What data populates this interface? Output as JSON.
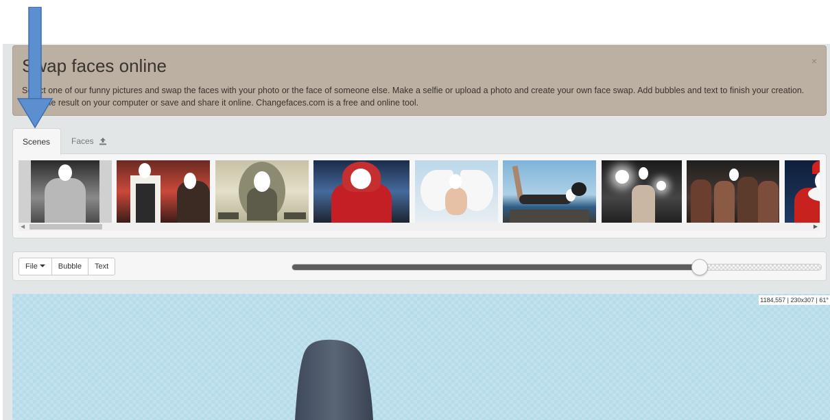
{
  "banner": {
    "title": "Swap faces online",
    "text": "Select one of our funny pictures and swap the faces with your photo or the face of someone else. Make a selfie or upload a photo and create your own face swap. Add bubbles and text to finish your creation. Save the result on your computer or save and share it online. Changefaces.com is a free and online tool.",
    "close": "×"
  },
  "tabs": [
    {
      "label": "Scenes",
      "active": true
    },
    {
      "label": "Faces",
      "icon": "upload-icon"
    }
  ],
  "scenes": [
    {
      "name": "statue-scene"
    },
    {
      "name": "bartender-scene"
    },
    {
      "name": "dollar-bill-scene"
    },
    {
      "name": "football-player-scene"
    },
    {
      "name": "angel-scene"
    },
    {
      "name": "yoga-beach-scene"
    },
    {
      "name": "paparazzi-scene"
    },
    {
      "name": "party-girls-scene"
    },
    {
      "name": "santa-scene"
    }
  ],
  "toolbar": {
    "file": "File",
    "bubble": "Bubble",
    "text": "Text",
    "slider_value": 0.77
  },
  "canvas": {
    "readout": "1184,557 | 230x307 | 61°"
  },
  "colors": {
    "banner": "#bcb0a2",
    "arrow": "#5b8fd0",
    "canvas": "#bcdeeb"
  }
}
